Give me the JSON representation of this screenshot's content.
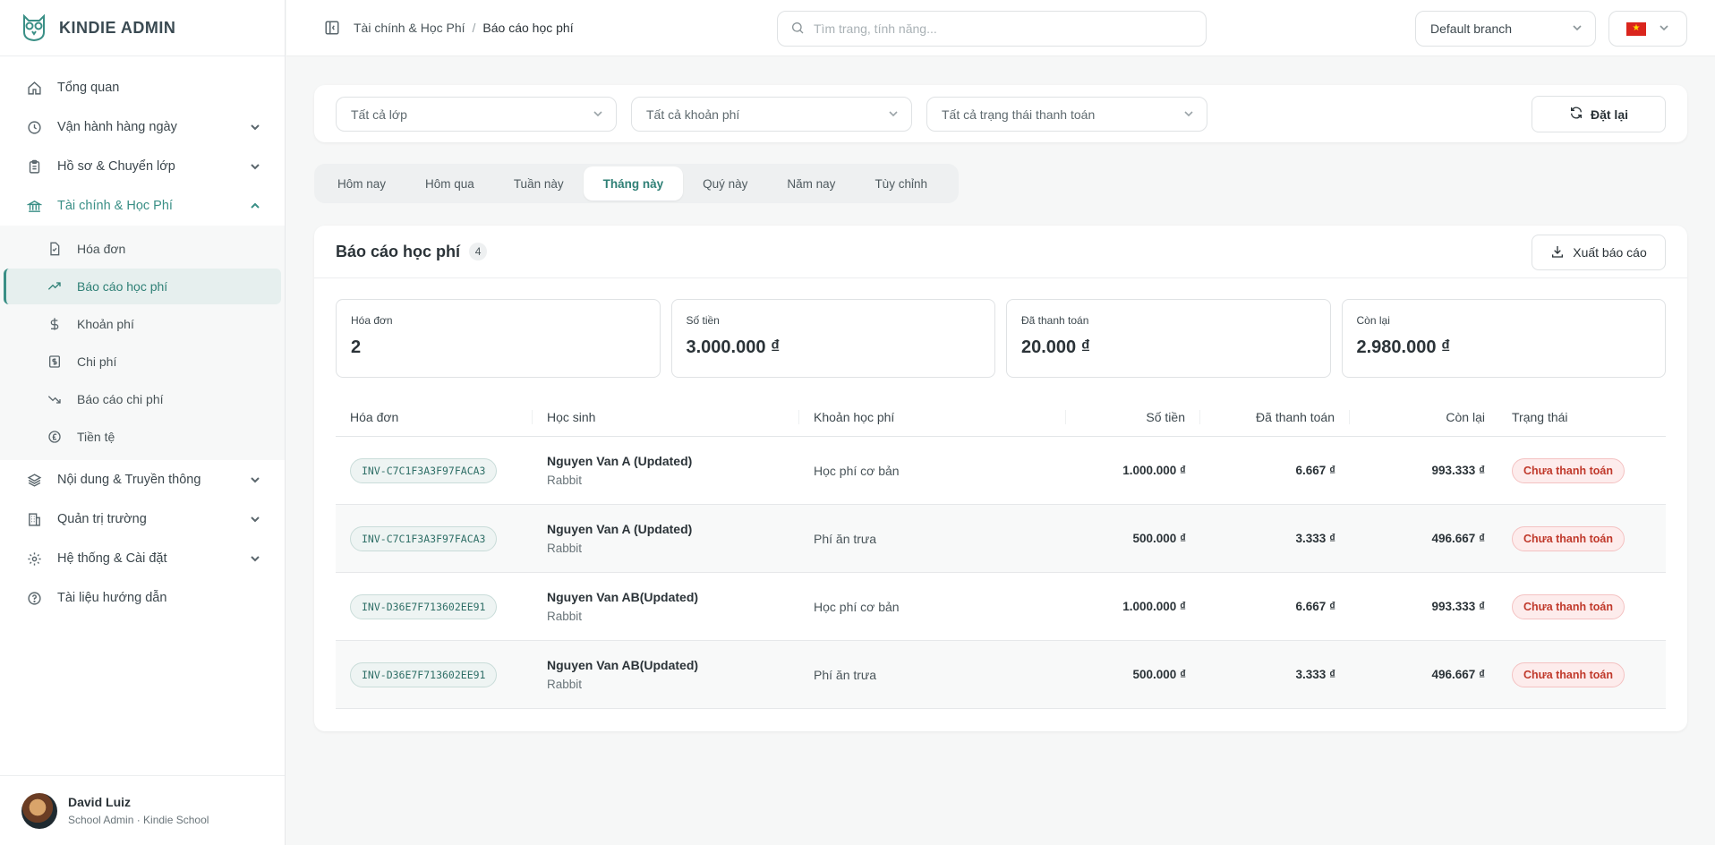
{
  "brand": {
    "name": "KINDIE ADMIN"
  },
  "sidebar": {
    "items": [
      {
        "label": "Tổng quan",
        "icon": "home-icon"
      },
      {
        "label": "Vận hành hàng ngày",
        "icon": "clock-icon"
      },
      {
        "label": "Hồ sơ & Chuyển lớp",
        "icon": "clipboard-icon"
      },
      {
        "label": "Tài chính & Học Phí",
        "icon": "bank-icon"
      },
      {
        "label": "Nội dung & Truyền thông",
        "icon": "layers-icon"
      },
      {
        "label": "Quản trị trường",
        "icon": "building-icon"
      },
      {
        "label": "Hệ thống & Cài đặt",
        "icon": "gear-icon"
      },
      {
        "label": "Tài liệu hướng dẫn",
        "icon": "help-icon"
      }
    ],
    "sub_items": [
      {
        "label": "Hóa đơn",
        "icon": "invoice-icon"
      },
      {
        "label": "Báo cáo học phí",
        "icon": "trend-up-icon"
      },
      {
        "label": "Khoản phí",
        "icon": "dollar-icon"
      },
      {
        "label": "Chi phí",
        "icon": "receipt-icon"
      },
      {
        "label": "Báo cáo chi phí",
        "icon": "trend-down-icon"
      },
      {
        "label": "Tiền tệ",
        "icon": "currency-icon"
      }
    ]
  },
  "user": {
    "name": "David Luiz",
    "role": "School Admin · Kindie School"
  },
  "header": {
    "breadcrumb": [
      "Tài chính & Học Phí",
      "/",
      "Báo cáo học phí"
    ],
    "search_placeholder": "Tìm trang, tính năng...",
    "branch": "Default branch",
    "flag_star": "★"
  },
  "filters": {
    "class": "Tất cả lớp",
    "fee": "Tất cả khoản phí",
    "payment_status": "Tất cả trạng thái thanh toán",
    "reset_label": "Đặt lại"
  },
  "periods": [
    "Hôm nay",
    "Hôm qua",
    "Tuần này",
    "Tháng này",
    "Quý này",
    "Năm nay",
    "Tùy chỉnh"
  ],
  "active_period": "Tháng này",
  "report": {
    "title": "Báo cáo học phí",
    "count": "4",
    "export_label": "Xuất báo cáo",
    "stats": [
      {
        "label": "Hóa đơn",
        "value": "2"
      },
      {
        "label": "Số tiền",
        "value": "3.000.000 ₫"
      },
      {
        "label": "Đã thanh toán",
        "value": "20.000 ₫"
      },
      {
        "label": "Còn lại",
        "value": "2.980.000 ₫"
      }
    ],
    "columns": [
      "Hóa đơn",
      "Học sinh",
      "Khoản học phí",
      "Số tiền",
      "Đã thanh toán",
      "Còn lại",
      "Trạng thái"
    ],
    "rows": [
      {
        "invoice": "INV-C7C1F3A3F97FACA3",
        "student": "Nguyen Van A (Updated)",
        "class": "Rabbit",
        "fee": "Học phí cơ bản",
        "amount": "1.000.000 ₫",
        "paid": "6.667 ₫",
        "remaining": "993.333 ₫",
        "status": "Chưa thanh toán"
      },
      {
        "invoice": "INV-C7C1F3A3F97FACA3",
        "student": "Nguyen Van A (Updated)",
        "class": "Rabbit",
        "fee": "Phí ăn trưa",
        "amount": "500.000 ₫",
        "paid": "3.333 ₫",
        "remaining": "496.667 ₫",
        "status": "Chưa thanh toán"
      },
      {
        "invoice": "INV-D36E7F713602EE91",
        "student": "Nguyen Van AB(Updated)",
        "class": "Rabbit",
        "fee": "Học phí cơ bản",
        "amount": "1.000.000 ₫",
        "paid": "6.667 ₫",
        "remaining": "993.333 ₫",
        "status": "Chưa thanh toán"
      },
      {
        "invoice": "INV-D36E7F713602EE91",
        "student": "Nguyen Van AB(Updated)",
        "class": "Rabbit",
        "fee": "Phí ăn trưa",
        "amount": "500.000 ₫",
        "paid": "3.333 ₫",
        "remaining": "496.667 ₫",
        "status": "Chưa thanh toán"
      }
    ]
  },
  "colors": {
    "accent": "#3a8f86",
    "status_unpaid": "#c0392b",
    "flag": "#da251d"
  }
}
